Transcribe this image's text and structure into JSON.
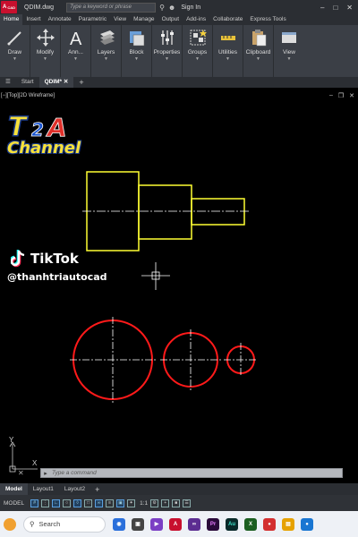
{
  "titlebar": {
    "app_logo": "A",
    "app_logo_sub": "CAD",
    "doc_title": "QDIM.dwg",
    "search_placeholder": "Type a keyword or phrase",
    "sign_in": "Sign In"
  },
  "ribbon_tabs": [
    "Home",
    "Insert",
    "Annotate",
    "Parametric",
    "View",
    "Manage",
    "Output",
    "Add-ins",
    "Collaborate",
    "Express Tools"
  ],
  "ribbon_panels": [
    {
      "label": "Draw",
      "icon": "pencil-icon"
    },
    {
      "label": "Modify",
      "icon": "move-icon"
    },
    {
      "label": "Ann...",
      "icon": "text-icon"
    },
    {
      "label": "Layers",
      "icon": "layers-icon"
    },
    {
      "label": "Block",
      "icon": "block-icon"
    },
    {
      "label": "Properties",
      "icon": "properties-icon"
    },
    {
      "label": "Groups",
      "icon": "groups-icon"
    },
    {
      "label": "Utilities",
      "icon": "measure-icon"
    },
    {
      "label": "Clipboard",
      "icon": "clipboard-icon"
    },
    {
      "label": "View",
      "icon": "view-icon"
    }
  ],
  "file_tabs": {
    "start": "Start",
    "active": "QDIM*"
  },
  "viewport": {
    "label": "[−][Top][2D Wireframe]"
  },
  "brand": {
    "logo_text": "T2A",
    "channel": "Channel",
    "tiktok": "TikTok",
    "handle": "@thanhtriautocad"
  },
  "ucs": {
    "y": "Y",
    "x": "X"
  },
  "command": {
    "placeholder": "Type a command"
  },
  "layout_tabs": [
    "Model",
    "Layout1",
    "Layout2"
  ],
  "status": {
    "model": "MODEL",
    "scale": "1:1"
  },
  "taskbar": {
    "search": "Search"
  },
  "colors": {
    "drawing_yellow": "#ffff33",
    "drawing_red": "#ff1a1a",
    "centerline": "#ffffff",
    "background": "#000000"
  }
}
